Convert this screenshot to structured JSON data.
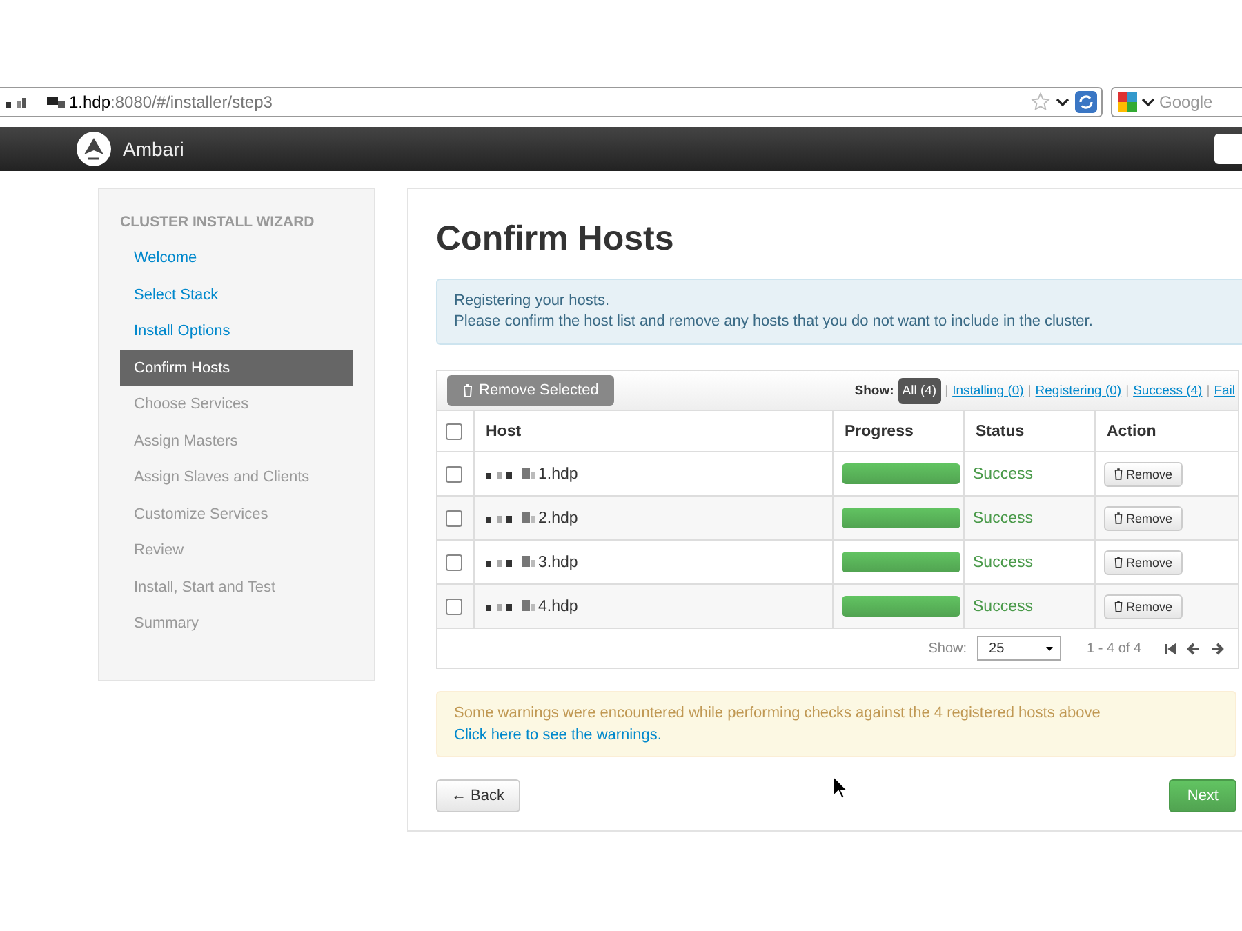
{
  "browser": {
    "url_host": "1.hdp",
    "url_path": ":8080/#/installer/step3",
    "search_placeholder": "Google"
  },
  "header": {
    "brand": "Ambari"
  },
  "sidebar": {
    "heading": "CLUSTER INSTALL WIZARD",
    "items": [
      {
        "label": "Welcome",
        "selected": false,
        "enabled": true
      },
      {
        "label": "Select Stack",
        "selected": false,
        "enabled": true
      },
      {
        "label": "Install Options",
        "selected": false,
        "enabled": true
      },
      {
        "label": "Confirm Hosts",
        "selected": true,
        "enabled": true
      },
      {
        "label": "Choose Services",
        "selected": false,
        "enabled": false
      },
      {
        "label": "Assign Masters",
        "selected": false,
        "enabled": false
      },
      {
        "label": "Assign Slaves and Clients",
        "selected": false,
        "enabled": false
      },
      {
        "label": "Customize Services",
        "selected": false,
        "enabled": false
      },
      {
        "label": "Review",
        "selected": false,
        "enabled": false
      },
      {
        "label": "Install, Start and Test",
        "selected": false,
        "enabled": false
      },
      {
        "label": "Summary",
        "selected": false,
        "enabled": false
      }
    ]
  },
  "main": {
    "title": "Confirm Hosts",
    "info": [
      "Registering your hosts.",
      "Please confirm the host list and remove any hosts that you do not want to include in the cluster."
    ],
    "remove_selected": "Remove Selected",
    "show_label": "Show:",
    "filter_separator": "|",
    "filters": [
      {
        "label": "All (4)",
        "selected": true
      },
      {
        "label": "Installing (0)",
        "selected": false
      },
      {
        "label": "Registering (0)",
        "selected": false
      },
      {
        "label": "Success (4)",
        "selected": false
      },
      {
        "label": "Fail",
        "selected": false
      }
    ],
    "select_all_checked": false,
    "columns": [
      "Host",
      "Progress",
      "Status",
      "Action"
    ],
    "rows": [
      {
        "host": "1.hdp",
        "checked": false,
        "level": 1,
        "status": "Success",
        "action": "Remove"
      },
      {
        "host": "2.hdp",
        "checked": false,
        "level": 1,
        "status": "Success",
        "action": "Remove"
      },
      {
        "host": "3.hdp",
        "checked": false,
        "level": 1,
        "status": "Success",
        "action": "Remove"
      },
      {
        "host": "4.hdp",
        "checked": false,
        "level": 1,
        "status": "Success",
        "action": "Remove"
      }
    ],
    "pager": {
      "show_label": "Show:",
      "page_size": "25",
      "range": "1 - 4 of 4"
    },
    "warning": {
      "text": "Some warnings were encountered while performing checks against the 4 registered hosts above",
      "link": "Click here to see the warnings."
    },
    "back": "← Back",
    "next": "Next"
  }
}
